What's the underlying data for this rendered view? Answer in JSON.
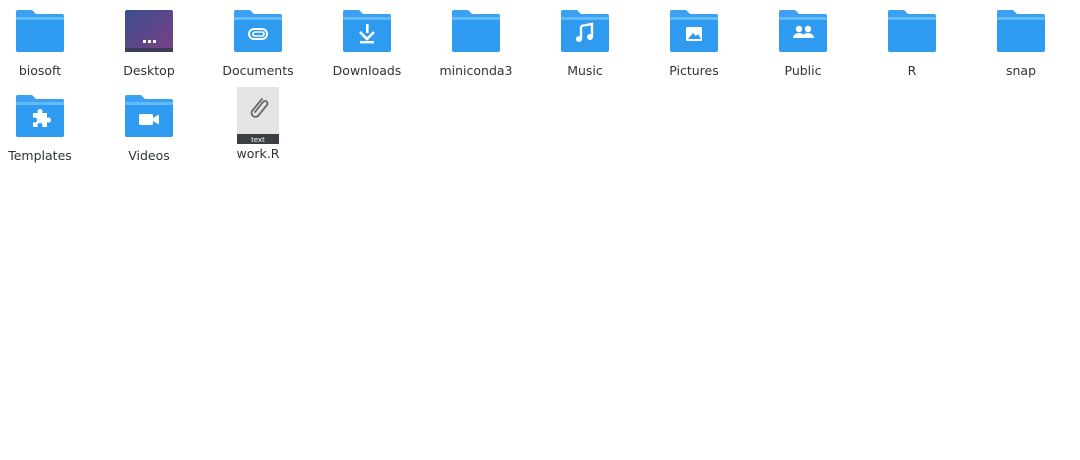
{
  "window": {
    "view": "icon-grid"
  },
  "colors": {
    "folder_tab": "#3ba0f2",
    "folder_body": "#2f9bf0",
    "folder_body_light": "#4fb0f7",
    "glyph": "#ffffff",
    "desktop_gradient_start": "#3c4f8c",
    "desktop_gradient_end": "#7a3f86",
    "text": "#2e3436"
  },
  "items": [
    {
      "label": "biosoft",
      "icon": "folder-icon",
      "type": "folder"
    },
    {
      "label": "Desktop",
      "icon": "desktop-folder-icon",
      "type": "folder"
    },
    {
      "label": "Documents",
      "icon": "documents-folder-icon",
      "type": "folder"
    },
    {
      "label": "Downloads",
      "icon": "downloads-folder-icon",
      "type": "folder"
    },
    {
      "label": "miniconda3",
      "icon": "folder-icon",
      "type": "folder"
    },
    {
      "label": "Music",
      "icon": "music-folder-icon",
      "type": "folder"
    },
    {
      "label": "Pictures",
      "icon": "pictures-folder-icon",
      "type": "folder"
    },
    {
      "label": "Public",
      "icon": "public-folder-icon",
      "type": "folder"
    },
    {
      "label": "R",
      "icon": "folder-icon",
      "type": "folder"
    },
    {
      "label": "snap",
      "icon": "folder-icon",
      "type": "folder"
    },
    {
      "label": "Templates",
      "icon": "templates-folder-icon",
      "type": "folder"
    },
    {
      "label": "Videos",
      "icon": "videos-folder-icon",
      "type": "folder"
    },
    {
      "label": "work.R",
      "icon": "text-file-icon",
      "type": "file",
      "badge": "text"
    }
  ]
}
